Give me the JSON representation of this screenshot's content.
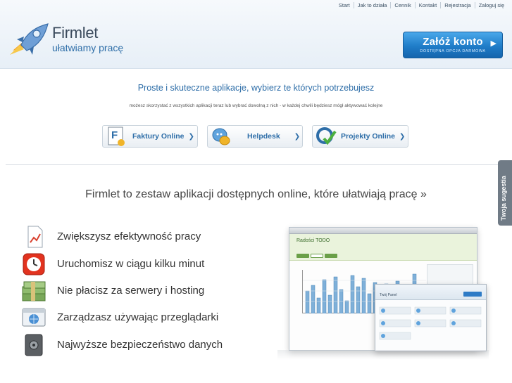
{
  "topnav": [
    "Start",
    "Jak to działa",
    "Cennik",
    "Kontakt",
    "Rejestracja",
    "Zaloguj się"
  ],
  "brand": {
    "name": "Firmlet",
    "tagline": "ułatwiamy pracę"
  },
  "cta": {
    "label": "Załóż konto",
    "sub": "DOSTĘPNA OPCJA DARMOWA"
  },
  "apps": {
    "title": "Proste i skuteczne aplikacje, wybierz te których potrzebujesz",
    "subtitle": "możesz skorzystać z wszystkich aplikacji teraz lub wybrać dowolną z nich - w każdej chwili będziesz mógł aktywować kolejne",
    "items": [
      {
        "label": "Faktury Online",
        "icon": "invoice-icon"
      },
      {
        "label": "Helpdesk",
        "icon": "helpdesk-icon"
      },
      {
        "label": "Projekty Online",
        "icon": "projects-icon"
      }
    ]
  },
  "headline": "Firmlet to zestaw aplikacji dostępnych online, które ułatwiają pracę »",
  "features": [
    {
      "label": "Zwiększysz efektywność pracy",
      "icon": "chart-document-icon"
    },
    {
      "label": "Uruchomisz w ciągu kilku minut",
      "icon": "clock-icon"
    },
    {
      "label": "Nie płacisz za serwery i hosting",
      "icon": "money-icon"
    },
    {
      "label": "Zarządzasz używając przeglądarki",
      "icon": "browser-icon"
    },
    {
      "label": "Najwyższe bezpieczeństwo danych",
      "icon": "safe-icon"
    }
  ],
  "side_tab": "Twoja sugestia",
  "screenshot": {
    "title": "Radości TODO",
    "panel_title": "Twój Panel"
  },
  "colors": {
    "accent": "#2e6ea8",
    "cta": "#1f7cc8",
    "tab": "#707b86"
  }
}
